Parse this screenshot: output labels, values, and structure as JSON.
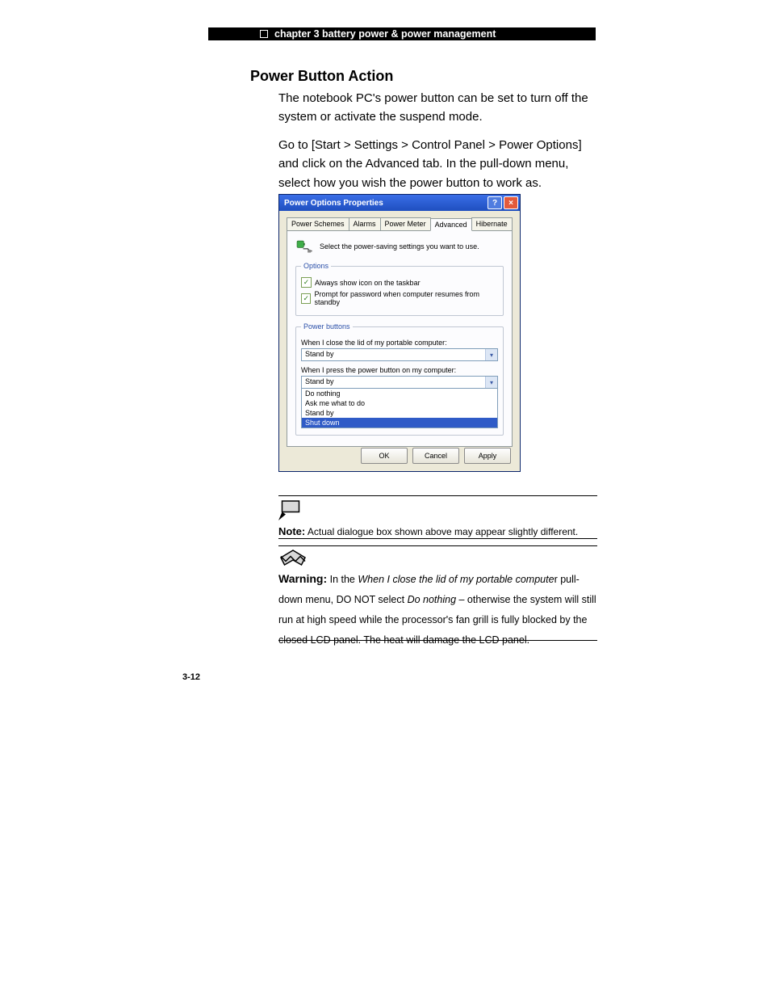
{
  "header": {
    "chapter": "chapter 3 battery power & power management"
  },
  "section_title": "Power Button Action",
  "para1": "The notebook PC's power button can be set to turn off the system or activate the suspend mode.",
  "para2": "Go to [Start > Settings > Control Panel > Power Options] and click on the Advanced tab. In the pull-down menu, select how you wish the power button to work as.",
  "dialog": {
    "title": "Power Options Properties",
    "tabs": {
      "t0": "Power Schemes",
      "t1": "Alarms",
      "t2": "Power Meter",
      "t3": "Advanced",
      "t4": "Hibernate"
    },
    "intro": "Select the power-saving settings you want to use.",
    "options": {
      "legend": "Options",
      "opt1": "Always show icon on the taskbar",
      "opt2": "Prompt for password when computer resumes from standby"
    },
    "power_buttons": {
      "legend": "Power buttons",
      "lid_label": "When I close the lid of my portable computer:",
      "lid_value": "Stand by",
      "btn_label": "When I press the power button on my computer:",
      "btn_value": "Stand by",
      "btn_options": {
        "o0": "Do nothing",
        "o1": "Ask me what to do",
        "o2": "Stand by",
        "o3": "Shut down"
      }
    },
    "buttons": {
      "ok": "OK",
      "cancel": "Cancel",
      "apply": "Apply"
    }
  },
  "note": {
    "label": "Note:",
    "text": " Actual dialogue box shown above may appear slightly different."
  },
  "warning": {
    "label": "Warning:",
    "pre": " In the ",
    "italic1": "When I close the lid of my portable compute",
    "r": "r",
    "mid1": " pull-down menu, DO NOT select ",
    "italic2": "Do nothing",
    "tail": " – otherwise the system will still run at high speed while the processor's fan grill is fully blocked by the closed LCD panel. The heat will damage the LCD panel."
  },
  "page_number": "3-12"
}
